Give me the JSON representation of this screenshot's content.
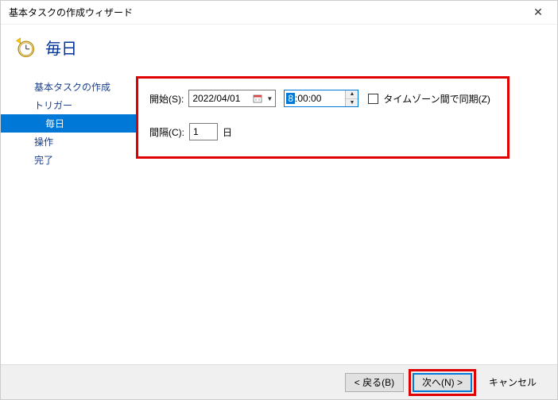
{
  "window": {
    "title": "基本タスクの作成ウィザード"
  },
  "header": {
    "title": "毎日"
  },
  "sidebar": {
    "items": [
      {
        "label": "基本タスクの作成",
        "level": 0,
        "selected": false
      },
      {
        "label": "トリガー",
        "level": 0,
        "selected": false
      },
      {
        "label": "毎日",
        "level": 1,
        "selected": true
      },
      {
        "label": "操作",
        "level": 0,
        "selected": false
      },
      {
        "label": "完了",
        "level": 0,
        "selected": false
      }
    ]
  },
  "form": {
    "start_label": "開始(S):",
    "date_value": "2022/04/01",
    "time_selected_part": "8",
    "time_rest_part": ":00:00",
    "timezone_label": "タイムゾーン間で同期(Z)",
    "timezone_checked": false,
    "interval_label": "間隔(C):",
    "interval_value": "1",
    "interval_unit": "日"
  },
  "footer": {
    "back": "< 戻る(B)",
    "next": "次へ(N) >",
    "cancel": "キャンセル"
  }
}
